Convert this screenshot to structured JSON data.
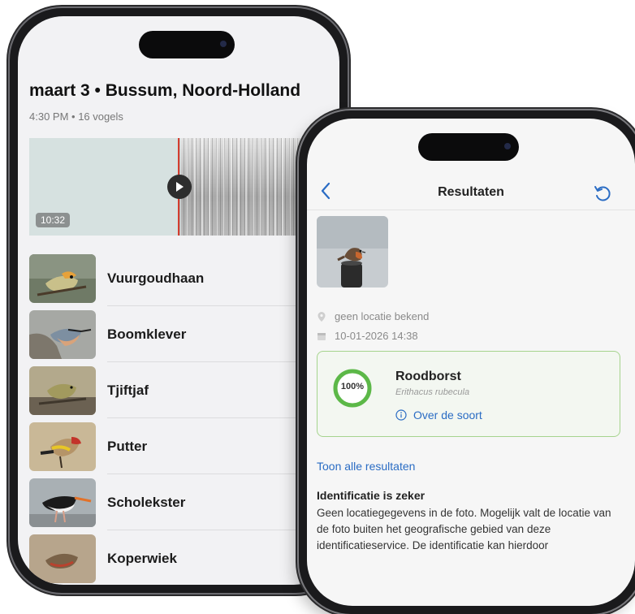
{
  "phone1": {
    "title": "maart 3 • Bussum, Noord-Holland",
    "subtitle": "4:30 PM • 16 vogels",
    "recording": {
      "duration": "10:32"
    },
    "species": [
      {
        "name": "Vuurgoudhaan"
      },
      {
        "name": "Boomklever"
      },
      {
        "name": "Tjiftjaf"
      },
      {
        "name": "Putter"
      },
      {
        "name": "Scholekster"
      },
      {
        "name": "Koperwiek"
      }
    ]
  },
  "phone2": {
    "header": {
      "title": "Resultaten"
    },
    "location": "geen locatie bekend",
    "datetime": "10-01-2026 14:38",
    "result": {
      "confidence_label": "100%",
      "confidence": 1.0,
      "name": "Roodborst",
      "latin": "Erithacus rubecula",
      "info_link": "Over de soort"
    },
    "all_results_link": "Toon alle resultaten",
    "identification": {
      "title": "Identificatie is zeker",
      "body": "Geen locatiegegevens in de foto. Mogelijk valt de locatie van de foto buiten het geografische gebied van deze identificatieservice. De identificatie kan hierdoor"
    }
  },
  "colors": {
    "accent": "#2a6cc4",
    "success": "#5cb848",
    "cursor": "#d43d2f"
  }
}
